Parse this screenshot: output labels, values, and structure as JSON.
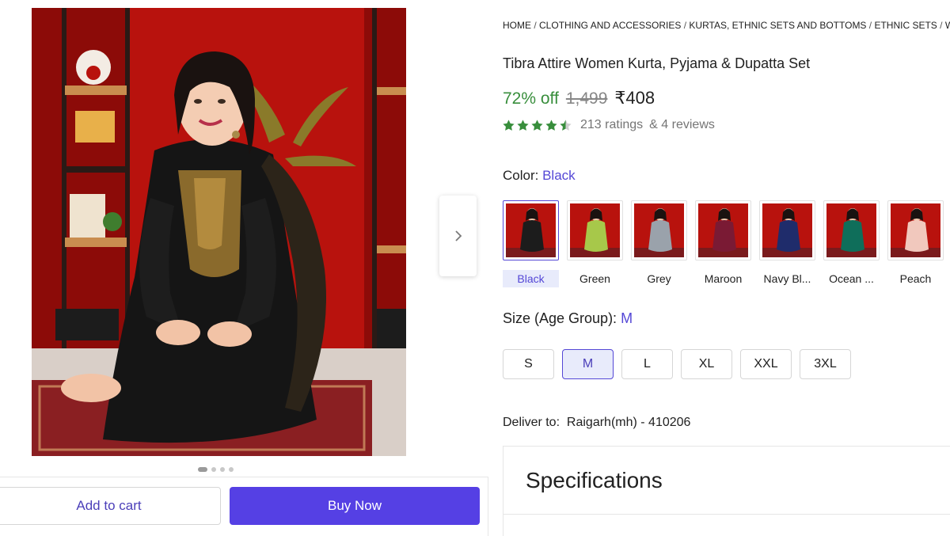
{
  "breadcrumb": {
    "items": [
      "HOME",
      "CLOTHING AND ACCESSORIES",
      "KURTAS, ETHNIC SETS AND BOTTOMS",
      "ETHNIC SETS",
      "WO"
    ],
    "separator": " / "
  },
  "product": {
    "title": "Tibra Attire Women Kurta, Pyjama & Dupatta Set",
    "discount": "72% off",
    "mrp": "1,499",
    "price": "₹408",
    "rating_value": 4.5,
    "ratings_text": "213 ratings",
    "reviews_text": "& 4 reviews"
  },
  "colors": {
    "label": "Color:",
    "selected": "Black",
    "options": [
      {
        "name": "Black",
        "hex": "#1c1c1c"
      },
      {
        "name": "Green",
        "hex": "#a7c84a"
      },
      {
        "name": "Grey",
        "hex": "#9aa2ab"
      },
      {
        "name": "Maroon",
        "hex": "#7a1a34"
      },
      {
        "name": "Navy Bl...",
        "hex": "#1f2c6b"
      },
      {
        "name": "Ocean ...",
        "hex": "#0f6e5a"
      },
      {
        "name": "Peach",
        "hex": "#f1c8bd"
      }
    ]
  },
  "sizes": {
    "label": "Size (Age Group):",
    "selected": "M",
    "options": [
      "S",
      "M",
      "L",
      "XL",
      "XXL",
      "3XL"
    ]
  },
  "delivery": {
    "label": "Deliver to:",
    "location": "Raigarh(mh) - 410206"
  },
  "specifications": {
    "title": "Specifications"
  },
  "actions": {
    "add_to_cart": "Add to cart",
    "buy_now": "Buy Now"
  },
  "carousel": {
    "slide_count": 4,
    "active_index": 0
  },
  "icons": {
    "next": "chevron-right-icon",
    "star": "star-icon"
  },
  "theme": {
    "accent": "#5447d6",
    "buy_button": "#5540e4",
    "discount_green": "#388e3c",
    "star_green": "#388e3c",
    "backdrop_red": "#b8120d"
  }
}
